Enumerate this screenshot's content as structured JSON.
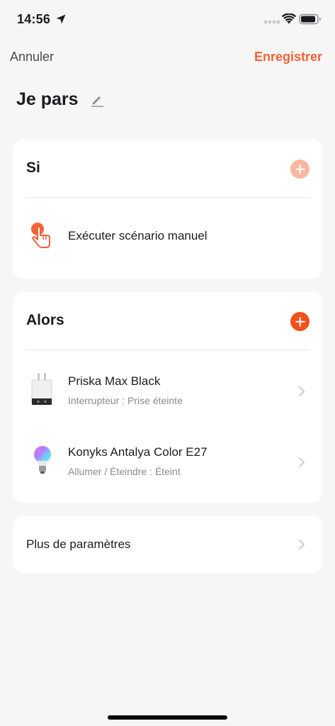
{
  "status_bar": {
    "time": "14:56",
    "icons": [
      "location-arrow-icon",
      "signal-dots-icon",
      "wifi-icon",
      "battery-icon"
    ]
  },
  "nav": {
    "cancel_label": "Annuler",
    "save_label": "Enregistrer"
  },
  "scene": {
    "title": "Je pars",
    "edit_icon": "pencil-icon"
  },
  "if_section": {
    "header": "Si",
    "add_icon": "plus-icon",
    "add_enabled": false,
    "condition": {
      "icon": "tap-hand-icon",
      "label": "Exécuter scénario manuel"
    }
  },
  "then_section": {
    "header": "Alors",
    "add_icon": "plus-icon",
    "add_enabled": true,
    "actions": [
      {
        "icon": "smart-plug-icon",
        "name": "Priska Max Black",
        "detail": "Interrupteur : Prise éteinte"
      },
      {
        "icon": "color-bulb-icon",
        "name": "Konyks Antalya Color E27",
        "detail": "Allumer / Éteindre : Éteint"
      }
    ]
  },
  "more": {
    "label": "Plus de paramètres"
  },
  "colors": {
    "accent": "#f26338",
    "accent_strong": "#f2511b",
    "accent_disabled": "#f9b7a1",
    "background": "#f6f6f6",
    "card": "#ffffff",
    "secondary_text": "#8a8a8e"
  }
}
